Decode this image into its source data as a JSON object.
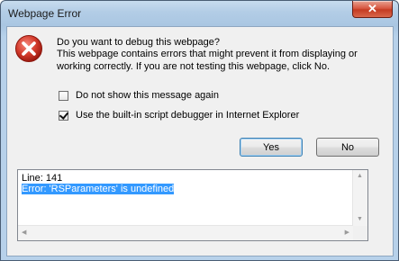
{
  "window": {
    "title": "Webpage Error"
  },
  "titlebar": {
    "close_glyph": "✕"
  },
  "message": {
    "question": "Do you want to debug this webpage?",
    "body": "This webpage contains errors that might prevent it from displaying or working correctly. If you are not testing this webpage, click No."
  },
  "options": {
    "dont_show": {
      "label": "Do not show this message again",
      "checked": false
    },
    "use_debugger": {
      "label": "Use the built-in script debugger in Internet Explorer",
      "checked": true
    }
  },
  "buttons": {
    "yes": "Yes",
    "no": "No"
  },
  "details": {
    "line": "Line: 141",
    "error": "Error: 'RSParameters' is undefined"
  },
  "icons": {
    "error": "error-icon",
    "close": "close-icon"
  },
  "colors": {
    "selection": "#3399ff",
    "close_button": "#c43b22",
    "error_icon": "#c8291d"
  }
}
